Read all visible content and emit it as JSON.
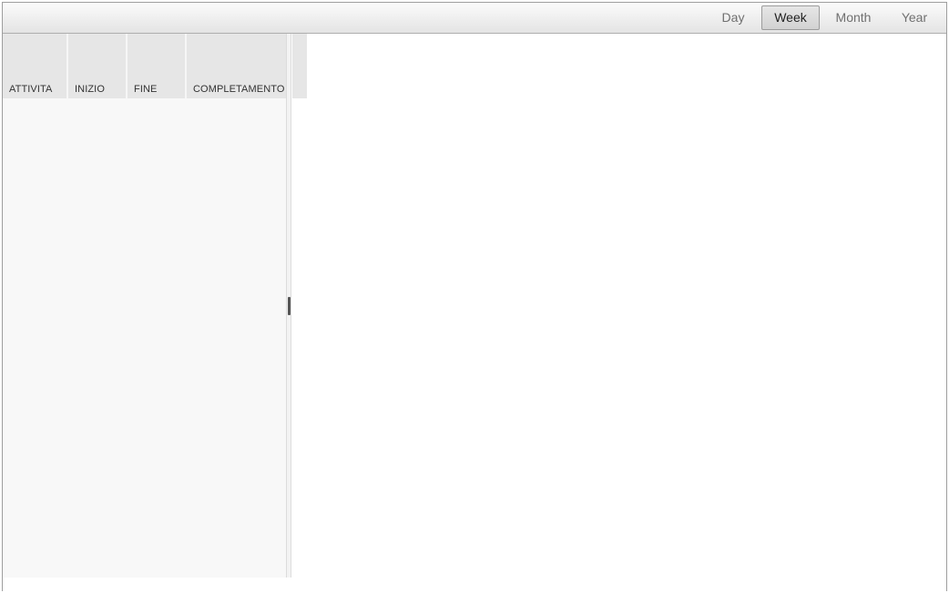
{
  "toolbar": {
    "views": [
      {
        "label": "Day",
        "active": false
      },
      {
        "label": "Week",
        "active": true
      },
      {
        "label": "Month",
        "active": false
      },
      {
        "label": "Year",
        "active": false
      }
    ]
  },
  "grid": {
    "columns": [
      {
        "label": "ATTIVITA"
      },
      {
        "label": "INIZIO"
      },
      {
        "label": "FINE"
      },
      {
        "label": "COMPLETAMENTO"
      }
    ],
    "rows": []
  },
  "colors": {
    "header_bg": "#e6e6e6",
    "grid_bg": "#f8f8f8",
    "border": "#9e9e9e"
  }
}
